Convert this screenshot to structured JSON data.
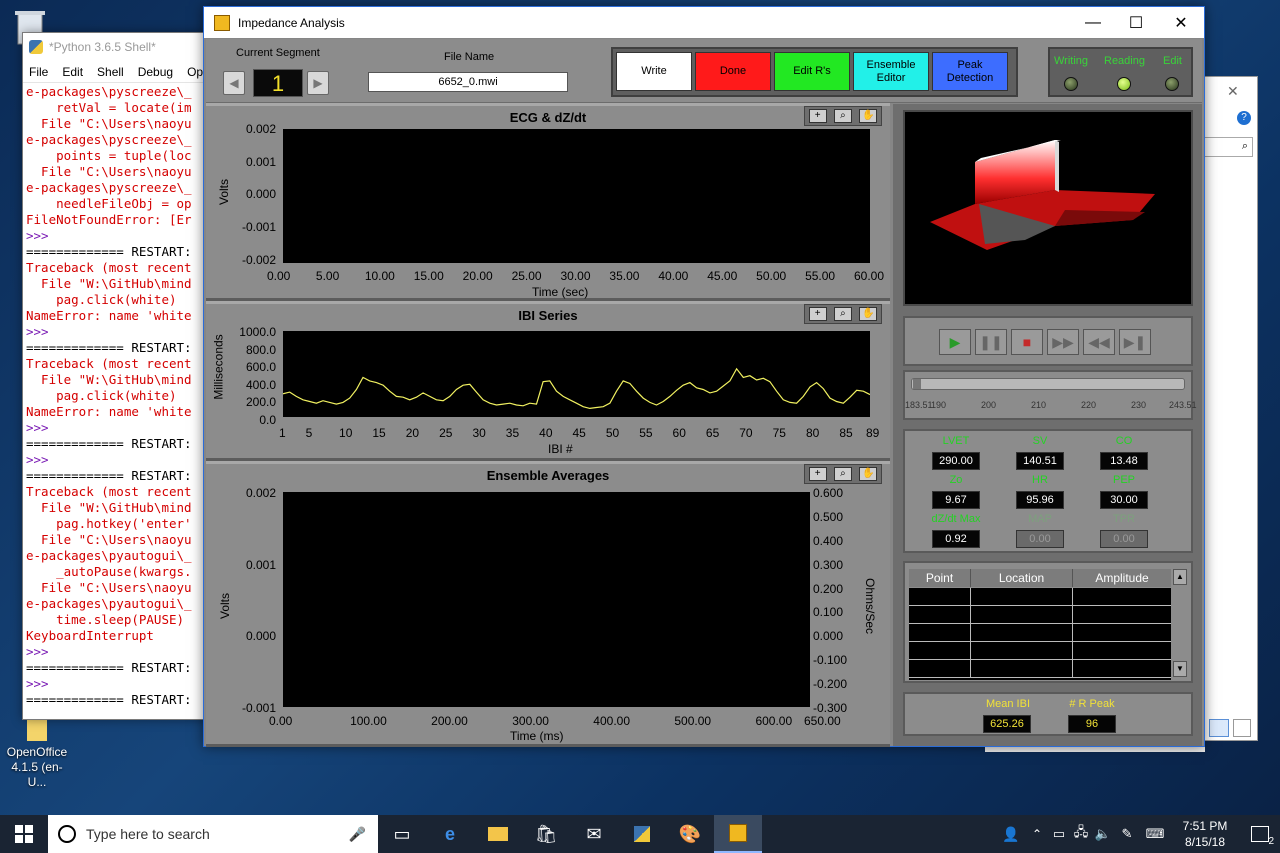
{
  "desktop": {
    "icons": [
      {
        "name": "recycle-bin",
        "label": "Re"
      },
      {
        "name": "openoffice",
        "label": "OpenOffice 4.1.5 (en-U..."
      }
    ]
  },
  "python_shell": {
    "title": "*Python 3.6.5 Shell*",
    "menu": [
      "File",
      "Edit",
      "Shell",
      "Debug",
      "Opti"
    ],
    "lines": [
      {
        "t": "e-packages\\pyscreeze\\_",
        "c": "r"
      },
      {
        "t": "    retVal = locate(im",
        "c": "r"
      },
      {
        "t": "  File \"C:\\Users\\naoyu",
        "c": "r"
      },
      {
        "t": "e-packages\\pyscreeze\\_",
        "c": "r"
      },
      {
        "t": "    points = tuple(loc",
        "c": "r"
      },
      {
        "t": "  File \"C:\\Users\\naoyu",
        "c": "r"
      },
      {
        "t": "e-packages\\pyscreeze\\_",
        "c": "r"
      },
      {
        "t": "    needleFileObj = op",
        "c": "r"
      },
      {
        "t": "FileNotFoundError: [Er",
        "c": "r"
      },
      {
        "t": ">>>",
        "c": "b"
      },
      {
        "t": "============= RESTART:",
        "c": ""
      },
      {
        "t": "Traceback (most recent",
        "c": "r"
      },
      {
        "t": "  File \"W:\\GitHub\\mind",
        "c": "r"
      },
      {
        "t": "    pag.click(white)",
        "c": "r"
      },
      {
        "t": "NameError: name 'white",
        "c": "r"
      },
      {
        "t": ">>>",
        "c": "b"
      },
      {
        "t": "============= RESTART:",
        "c": ""
      },
      {
        "t": "Traceback (most recent",
        "c": "r"
      },
      {
        "t": "  File \"W:\\GitHub\\mind",
        "c": "r"
      },
      {
        "t": "    pag.click(white)",
        "c": "r"
      },
      {
        "t": "NameError: name 'white",
        "c": "r"
      },
      {
        "t": ">>>",
        "c": "b"
      },
      {
        "t": "============= RESTART:",
        "c": ""
      },
      {
        "t": ">>>",
        "c": "b"
      },
      {
        "t": "============= RESTART:",
        "c": ""
      },
      {
        "t": "Traceback (most recent",
        "c": "r"
      },
      {
        "t": "  File \"W:\\GitHub\\mind",
        "c": "r"
      },
      {
        "t": "    pag.hotkey('enter'",
        "c": "r"
      },
      {
        "t": "  File \"C:\\Users\\naoyu",
        "c": "r"
      },
      {
        "t": "e-packages\\pyautogui\\_",
        "c": "r"
      },
      {
        "t": "    _autoPause(kwargs.",
        "c": "r"
      },
      {
        "t": "  File \"C:\\Users\\naoyu",
        "c": "r"
      },
      {
        "t": "e-packages\\pyautogui\\_",
        "c": "r"
      },
      {
        "t": "    time.sleep(PAUSE)",
        "c": "r"
      },
      {
        "t": "KeyboardInterrupt",
        "c": "r"
      },
      {
        "t": ">>>",
        "c": "b"
      },
      {
        "t": "============= RESTART:",
        "c": ""
      },
      {
        "t": ">>>",
        "c": "b"
      },
      {
        "t": "============= RESTART:",
        "c": ""
      }
    ]
  },
  "app": {
    "title": "Impedance Analysis",
    "window_controls": {
      "minimize": "—",
      "maximize": "☐",
      "close": "✕"
    },
    "segment": {
      "label": "Current Segment",
      "value": "1",
      "prev": "◀",
      "next": "▶"
    },
    "file": {
      "label": "File Name",
      "value": "6652_0.mwi"
    },
    "buttons": [
      {
        "key": "write",
        "label": "Write",
        "color": "#ffffff"
      },
      {
        "key": "done",
        "label": "Done",
        "color": "#ff1a1a"
      },
      {
        "key": "edit-rs",
        "label": "Edit R's",
        "color": "#22e822"
      },
      {
        "key": "ensemble-editor",
        "label": "Ensemble Editor",
        "color": "#22f0e8"
      },
      {
        "key": "peak-detection",
        "label": "Peak Detection",
        "color": "#3d6dff"
      }
    ],
    "indicators": [
      {
        "label": "Writing",
        "on": false
      },
      {
        "label": "Reading",
        "on": true
      },
      {
        "label": "Edit",
        "on": false
      }
    ]
  },
  "charts": {
    "ecg": {
      "title": "ECG & dZ/dt",
      "ylabel": "Volts",
      "xlabel": "Time (sec)",
      "yticks": [
        "0.002",
        "0.001",
        "0.000",
        "-0.001",
        "-0.002"
      ],
      "xticks": [
        "0.00",
        "5.00",
        "10.00",
        "15.00",
        "20.00",
        "25.00",
        "30.00",
        "35.00",
        "40.00",
        "45.00",
        "50.00",
        "55.00",
        "60.00"
      ]
    },
    "ibi": {
      "title": "IBI Series",
      "ylabel": "Milliseconds",
      "xlabel": "IBI #",
      "yticks": [
        "1000.0",
        "800.0",
        "600.0",
        "400.0",
        "200.0",
        "0.0"
      ],
      "xticks": [
        "1",
        "5",
        "10",
        "15",
        "20",
        "25",
        "30",
        "35",
        "40",
        "45",
        "50",
        "55",
        "60",
        "65",
        "70",
        "75",
        "80",
        "85",
        "89"
      ]
    },
    "ensemble": {
      "title": "Ensemble Averages",
      "ylabel": "Volts",
      "y2label": "Ohms/Sec",
      "xlabel": "Time (ms)",
      "yticks": [
        "0.002",
        "0.001",
        "0.000",
        "-0.001"
      ],
      "y2ticks": [
        "0.600",
        "0.500",
        "0.400",
        "0.300",
        "0.200",
        "0.100",
        "0.000",
        "-0.100",
        "-0.200",
        "-0.300"
      ],
      "xticks": [
        "0.00",
        "100.00",
        "200.00",
        "300.00",
        "400.00",
        "500.00",
        "600.00",
        "650.00"
      ]
    },
    "tool_icons": [
      "+",
      "⌕",
      "✋"
    ]
  },
  "chart_data": [
    {
      "type": "line",
      "title": "ECG & dZ/dt",
      "xlabel": "Time (sec)",
      "ylabel": "Volts",
      "xlim": [
        0,
        60
      ],
      "ylim": [
        -0.002,
        0.002
      ],
      "series": []
    },
    {
      "type": "line",
      "title": "IBI Series",
      "xlabel": "IBI #",
      "ylabel": "Milliseconds",
      "xlim": [
        1,
        89
      ],
      "ylim": [
        0,
        1000
      ],
      "color": "#f0f060",
      "x": [
        1,
        2,
        3,
        4,
        5,
        6,
        7,
        8,
        9,
        10,
        11,
        12,
        13,
        14,
        15,
        16,
        17,
        18,
        19,
        20,
        21,
        22,
        23,
        24,
        25,
        26,
        27,
        28,
        29,
        30,
        31,
        32,
        33,
        34,
        35,
        36,
        37,
        38,
        39,
        40,
        41,
        42,
        43,
        44,
        45,
        46,
        47,
        48,
        49,
        50,
        51,
        52,
        53,
        54,
        55,
        56,
        57,
        58,
        59,
        60,
        61,
        62,
        63,
        64,
        65,
        66,
        67,
        68,
        69,
        70,
        71,
        72,
        73,
        74,
        75,
        76,
        77,
        78,
        79,
        80,
        81,
        82,
        83,
        84,
        85,
        86,
        87,
        88,
        89
      ],
      "values": [
        270,
        290,
        240,
        200,
        180,
        160,
        190,
        170,
        150,
        170,
        220,
        320,
        460,
        420,
        400,
        370,
        300,
        240,
        230,
        200,
        230,
        280,
        240,
        200,
        190,
        240,
        320,
        370,
        380,
        290,
        200,
        160,
        140,
        150,
        160,
        140,
        130,
        160,
        150,
        410,
        420,
        300,
        240,
        200,
        160,
        120,
        100,
        110,
        120,
        160,
        300,
        420,
        390,
        300,
        220,
        170,
        140,
        180,
        240,
        310,
        370,
        400,
        340,
        320,
        280,
        300,
        360,
        420,
        560,
        460,
        480,
        430,
        450,
        410,
        300,
        200,
        170,
        160,
        240,
        350,
        400,
        330,
        220,
        180,
        160,
        230,
        310,
        300,
        260
      ]
    },
    {
      "type": "line",
      "title": "Ensemble Averages",
      "xlabel": "Time (ms)",
      "ylabel": "Volts",
      "xlim": [
        0,
        650
      ],
      "ylim": [
        -0.001,
        0.002
      ],
      "series": []
    }
  ],
  "transport": [
    "▶",
    "❚❚",
    "■",
    "▶▶",
    "◀◀",
    "▶❚"
  ],
  "slider": {
    "ticks": [
      "183.51",
      "190",
      "200",
      "210",
      "220",
      "230",
      "243.51"
    ]
  },
  "metrics": [
    {
      "label": "LVET",
      "value": "290.00",
      "active": true
    },
    {
      "label": "SV",
      "value": "140.51",
      "active": true
    },
    {
      "label": "CO",
      "value": "13.48",
      "active": true
    },
    {
      "label": "Zo",
      "value": "9.67",
      "active": true
    },
    {
      "label": "HR",
      "value": "95.96",
      "active": true
    },
    {
      "label": "PEP",
      "value": "30.00",
      "active": true
    },
    {
      "label": "dZ/dt Max",
      "value": "0.92",
      "active": true
    },
    {
      "label": "MAP",
      "value": "0.00",
      "active": false
    },
    {
      "label": "TPR",
      "value": "0.00",
      "active": false
    }
  ],
  "table": {
    "columns": [
      "Point",
      "Location",
      "Amplitude"
    ],
    "rows": 5
  },
  "summary": [
    {
      "label": "Mean IBI",
      "value": "625.26"
    },
    {
      "label": "# R Peak",
      "value": "96"
    }
  ],
  "taskbar": {
    "search_placeholder": "Type here to search",
    "time": "7:51 PM",
    "date": "8/15/18",
    "notifications": "2"
  }
}
